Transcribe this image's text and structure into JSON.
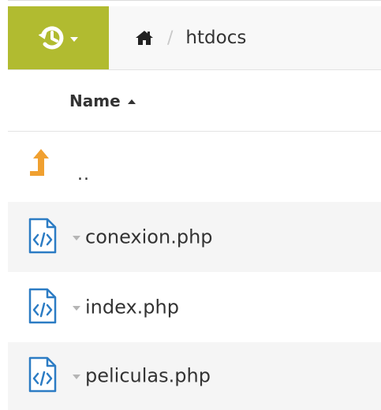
{
  "toolbar": {
    "history_icon": "history-icon",
    "home_icon": "home-icon",
    "separator": "/",
    "current_folder": "htdocs",
    "accent_color": "#b1bb30"
  },
  "list": {
    "column_name": "Name",
    "sort": "ascending",
    "parent_label": "..",
    "files": [
      {
        "name": "conexion.php",
        "icon": "php-file-icon"
      },
      {
        "name": "index.php",
        "icon": "php-file-icon"
      },
      {
        "name": "peliculas.php",
        "icon": "php-file-icon"
      }
    ]
  },
  "colors": {
    "up_arrow": "#f0a030",
    "file_icon": "#2c7cc4"
  }
}
